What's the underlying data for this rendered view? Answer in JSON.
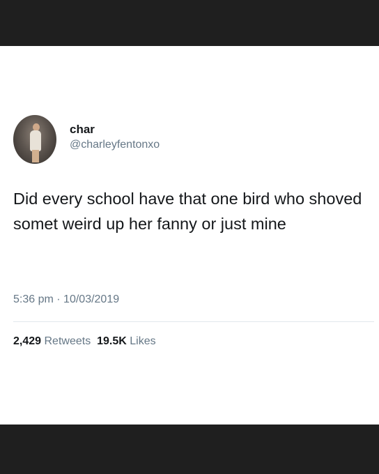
{
  "tweet": {
    "display_name": "char",
    "handle": "@charleyfentonxo",
    "text": "Did every school have that one bird who shoved somet weird up her fanny or just mine",
    "time": "5:36 pm",
    "separator": "·",
    "date": "10/03/2019",
    "retweets_count": "2,429",
    "retweets_label": "Retweets",
    "likes_count": "19.5K",
    "likes_label": "Likes"
  },
  "colors": {
    "text_primary": "#14171a",
    "text_secondary": "#657786",
    "divider": "#e1e8ed",
    "background": "#ffffff",
    "frame": "#1f1f1f"
  }
}
